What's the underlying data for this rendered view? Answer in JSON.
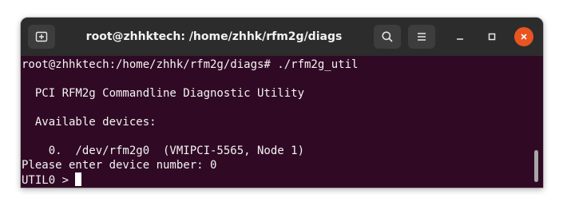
{
  "window": {
    "title": "root@zhhktech: /home/zhhk/rfm2g/diags",
    "icons": {
      "new_tab": "new-tab-icon",
      "search": "search-icon",
      "menu": "hamburger-menu-icon",
      "minimize": "minimize-icon",
      "maximize": "maximize-icon",
      "close": "close-icon"
    },
    "close_color": "#e95420"
  },
  "terminal": {
    "background": "#300a24",
    "lines": [
      "root@zhhktech:/home/zhhk/rfm2g/diags# ./rfm2g_util",
      "",
      "  PCI RFM2g Commandline Diagnostic Utility",
      "",
      "  Available devices:",
      "",
      "    0.  /dev/rfm2g0  (VMIPCI-5565, Node 1)",
      "Please enter device number: 0"
    ],
    "prompt": "UTIL0 > "
  }
}
